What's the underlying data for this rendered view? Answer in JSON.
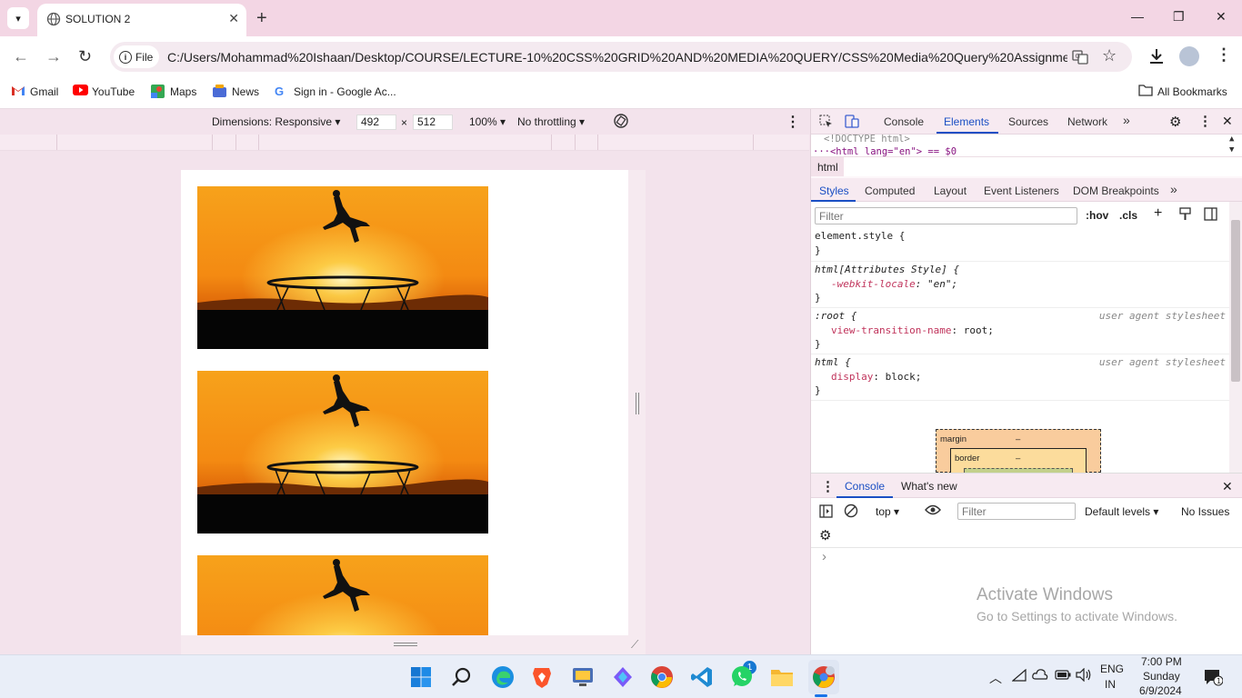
{
  "tab": {
    "title": "SOLUTION 2",
    "close": "✕"
  },
  "window": {
    "minimize": "—",
    "restore": "❐",
    "close": "✕"
  },
  "newtab": "+",
  "toolbar": {
    "file_chip": "File",
    "url": "C:/Users/Mohammad%20Ishaan/Desktop/COURSE/LECTURE-10%20CSS%20GRID%20AND%20MEDIA%20QUERY/CSS%20Media%20Query%20Assignment/SO..."
  },
  "bookmarks": {
    "items": [
      "Gmail",
      "YouTube",
      "Maps",
      "News",
      "Sign in - Google Ac..."
    ],
    "all": "All Bookmarks"
  },
  "device": {
    "dimensions": "Dimensions: Responsive",
    "width": "492",
    "times": "×",
    "height": "512",
    "zoom": "100%",
    "throttling": "No throttling"
  },
  "devtools": {
    "tabs": [
      "Console",
      "Elements",
      "Sources",
      "Network"
    ],
    "more": "»",
    "dom": [
      "<!DOCTYPE html>",
      "···<html lang=\"en\"> == $0"
    ],
    "crumb": "html",
    "styles_tabs": [
      "Styles",
      "Computed",
      "Layout",
      "Event Listeners",
      "DOM Breakpoints"
    ],
    "filter_placeholder": "Filter",
    "hov": ":hov",
    "cls": ".cls",
    "rules": [
      {
        "selector": "element.style {",
        "props": [],
        "close": "}"
      },
      {
        "selector": "html[Attributes Style] {",
        "props": [
          {
            "name": "-webkit-locale",
            "value": "\"en\";"
          }
        ],
        "close": "}"
      },
      {
        "selector": ":root {",
        "source": "user agent stylesheet",
        "props": [
          {
            "name": "view-transition-name",
            "value": "root;"
          }
        ],
        "close": "}"
      },
      {
        "selector": "html {",
        "source": "user agent stylesheet",
        "props": [
          {
            "name": "display",
            "value": "block;"
          }
        ],
        "close": "}"
      }
    ],
    "boxmodel": {
      "margin": "margin",
      "margin_val": "–",
      "border": "border",
      "border_val": "–"
    }
  },
  "console": {
    "tabs": [
      "Console",
      "What's new"
    ],
    "context": "top",
    "filter_placeholder": "Filter",
    "levels": "Default levels",
    "issues": "No Issues",
    "prompt": "›"
  },
  "watermark": {
    "title": "Activate Windows",
    "subtitle": "Go to Settings to activate Windows."
  },
  "taskbar": {
    "lang1": "ENG",
    "lang2": "IN",
    "time": "7:00 PM",
    "day": "Sunday",
    "date": "6/9/2024",
    "vscode_badge": "1"
  },
  "colors": {
    "sunset_top": "#f7a21b",
    "sunset_mid": "#f48a12",
    "ground": "#050505"
  }
}
